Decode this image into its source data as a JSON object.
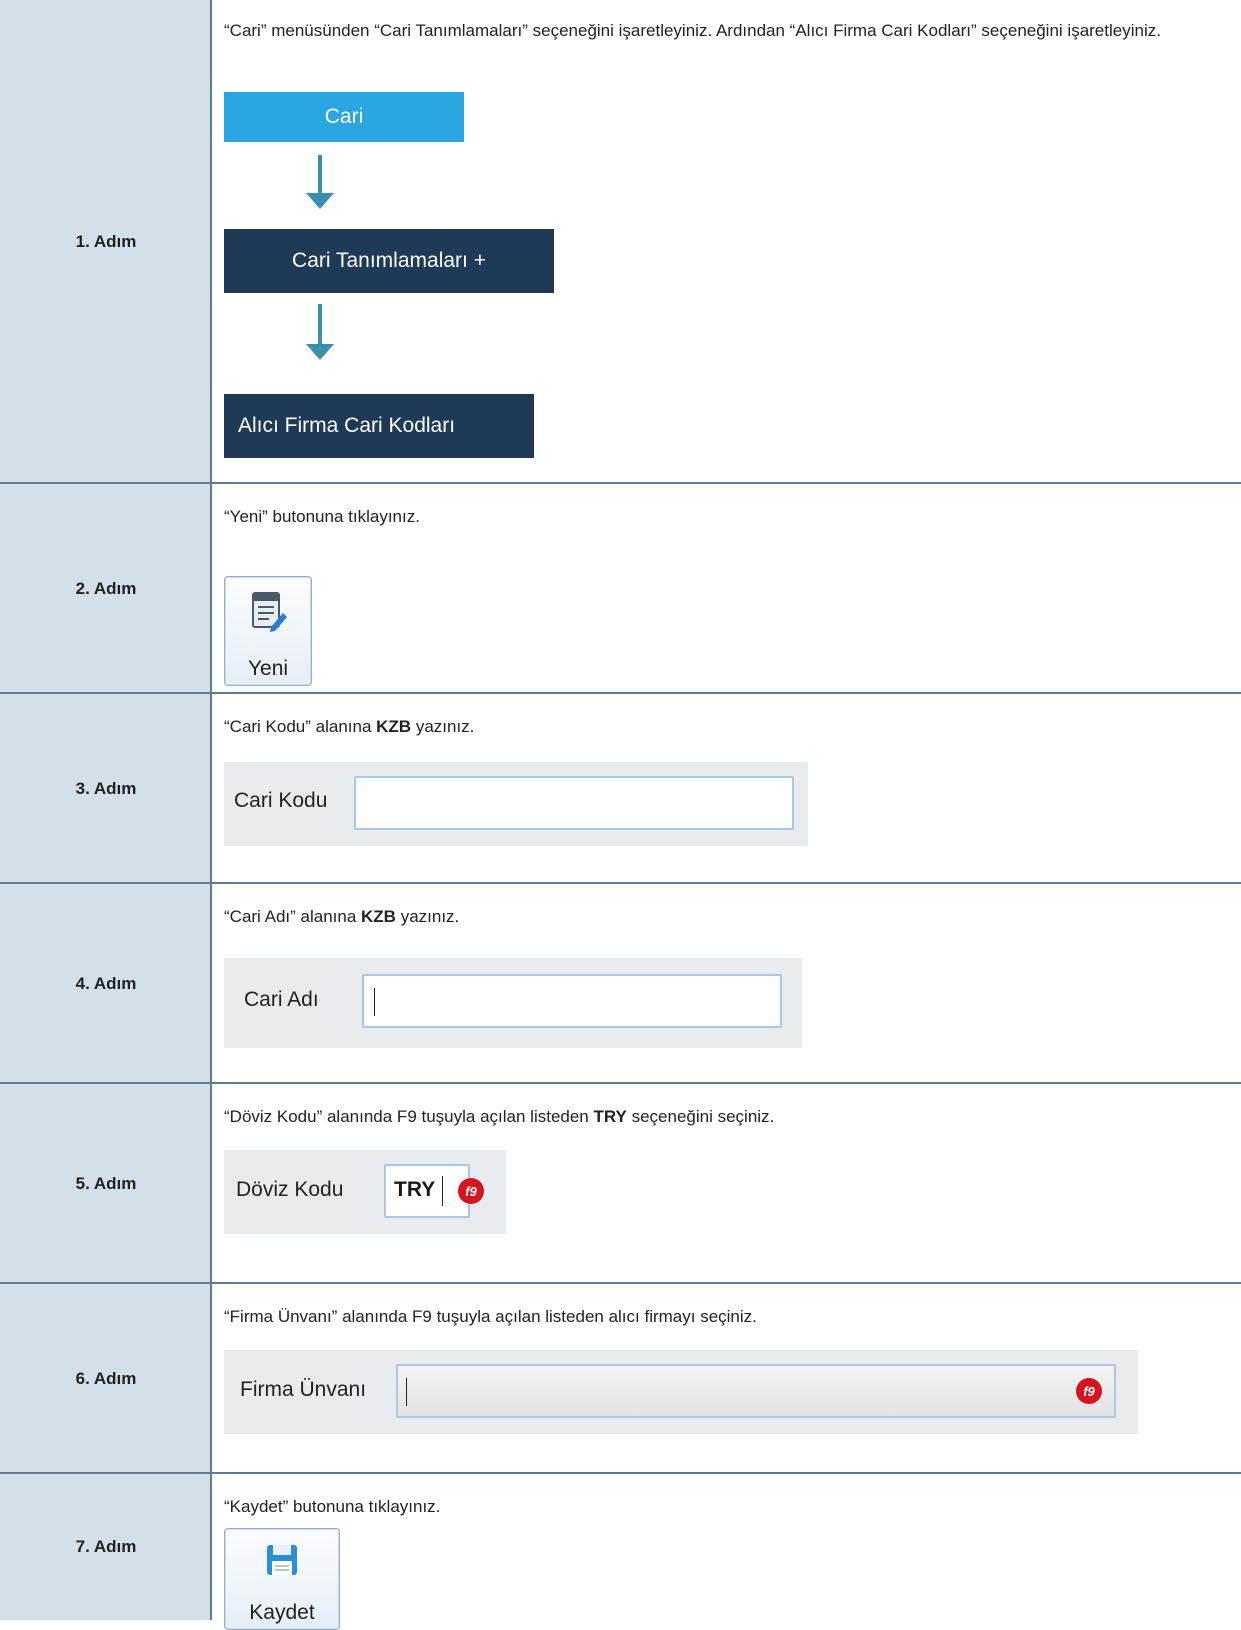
{
  "steps": [
    {
      "label": "1. Adım",
      "instruction_parts": [
        "“Cari” menüsünden “Cari Tanımlamaları” seçeneğini işaretleyiniz. Ardından “Alıcı Firma Cari Kodları” seçeneğini işaretleyiniz."
      ],
      "menu": [
        "Cari",
        "Cari Tanımlamaları +",
        "Alıcı Firma Cari Kodları"
      ]
    },
    {
      "label": "2. Adım",
      "instruction": "“Yeni” butonuna tıklayınız.",
      "button": "Yeni"
    },
    {
      "label": "3. Adım",
      "instruction_pre": "“Cari Kodu” alanına ",
      "instruction_bold": "KZB",
      "instruction_post": " yazınız.",
      "field_label": "Cari Kodu"
    },
    {
      "label": "4. Adım",
      "instruction_pre": "“Cari Adı” alanına ",
      "instruction_bold": "KZB",
      "instruction_post": " yazınız.",
      "field_label": "Cari Adı"
    },
    {
      "label": "5. Adım",
      "instruction_pre": "“Döviz Kodu” alanında F9 tuşuyla açılan listeden ",
      "instruction_bold": "TRY",
      "instruction_post": " seçeneğini seçiniz.",
      "field_label": "Döviz Kodu",
      "field_value": "TRY",
      "f9": "f9"
    },
    {
      "label": "6. Adım",
      "instruction": "“Firma Ünvanı” alanında F9 tuşuyla açılan listeden alıcı firmayı seçiniz.",
      "field_label": "Firma Ünvanı",
      "f9": "f9"
    },
    {
      "label": "7. Adım",
      "instruction": "“Kaydet” butonuna tıklayınız.",
      "button": "Kaydet"
    }
  ],
  "colors": {
    "sidebar": "#d3dfe9",
    "menu_blue": "#2aa7e0",
    "menu_dark": "#1e3a56",
    "arrow": "#3a8fb0",
    "f9_red": "#d6141f"
  },
  "icons": {
    "yeni": "new-document-icon",
    "kaydet": "save-disk-icon"
  }
}
